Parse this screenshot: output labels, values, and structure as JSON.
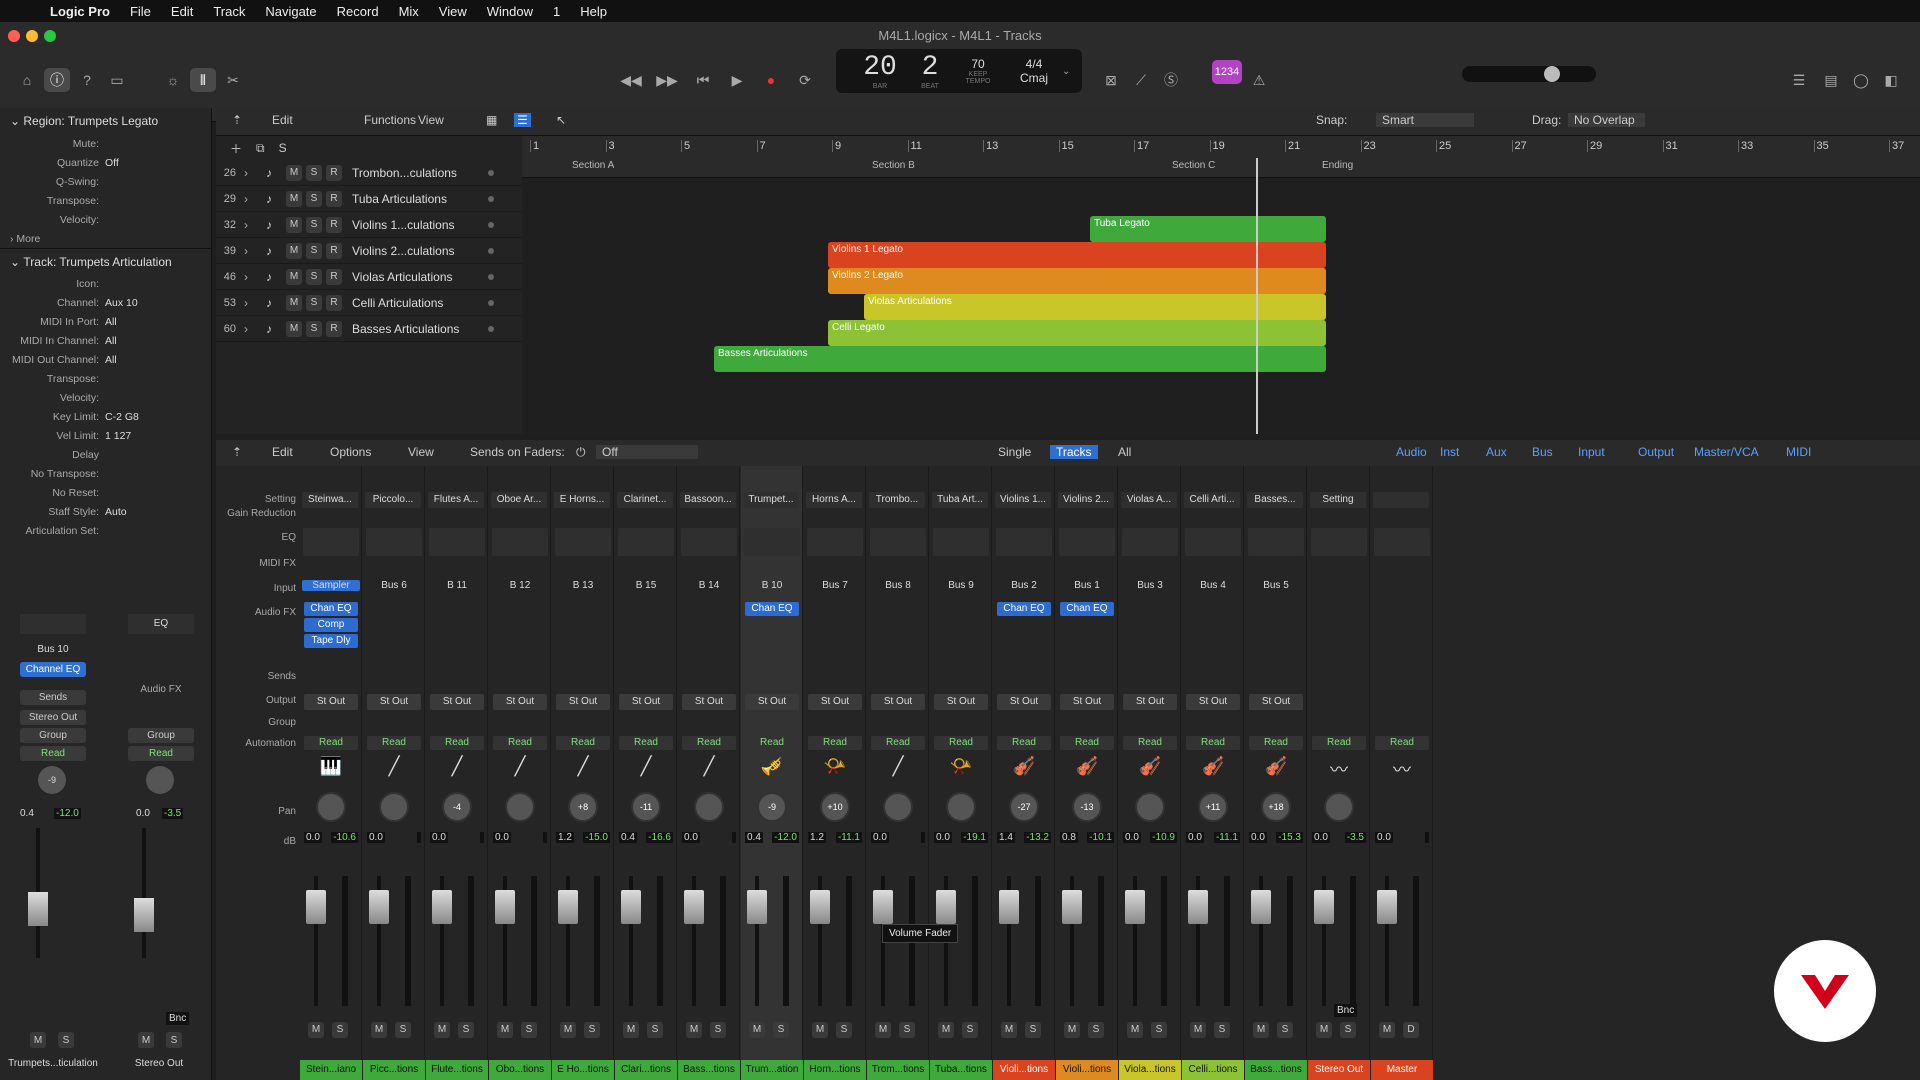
{
  "menubar": {
    "app": "Logic Pro",
    "items": [
      "File",
      "Edit",
      "Track",
      "Navigate",
      "Record",
      "Mix",
      "View",
      "Window",
      "1",
      "Help"
    ]
  },
  "window": {
    "title": "M4L1.logicx - M4L1 - Tracks"
  },
  "lcd": {
    "bar": "20",
    "beat": "2",
    "bar_label": "BAR",
    "beat_label": "BEAT",
    "tempo": "70",
    "keep": "KEEP",
    "tempo_label": "TEMPO",
    "sig": "4/4",
    "key": "Cmaj"
  },
  "cpu": {
    "label": "1234"
  },
  "inspector": {
    "region_header": "Region: Trumpets Legato",
    "region_rows": [
      {
        "k": "Mute:",
        "v": ""
      },
      {
        "k": "Quantize",
        "v": "Off"
      },
      {
        "k": "Q-Swing:",
        "v": ""
      },
      {
        "k": "Transpose:",
        "v": ""
      },
      {
        "k": "Velocity:",
        "v": ""
      }
    ],
    "more": "More",
    "track_header": "Track: Trumpets Articulation",
    "track_rows": [
      {
        "k": "Icon:",
        "v": ""
      },
      {
        "k": "Channel:",
        "v": "Aux 10"
      },
      {
        "k": "MIDI In Port:",
        "v": "All"
      },
      {
        "k": "MIDI In Channel:",
        "v": "All"
      },
      {
        "k": "MIDI Out Channel:",
        "v": "All"
      },
      {
        "k": "Transpose:",
        "v": ""
      },
      {
        "k": "Velocity:",
        "v": ""
      },
      {
        "k": "Key Limit:",
        "v": "C-2  G8"
      },
      {
        "k": "Vel Limit:",
        "v": "1  127"
      },
      {
        "k": "Delay",
        "v": ""
      },
      {
        "k": "No Transpose:",
        "v": ""
      },
      {
        "k": "No Reset:",
        "v": ""
      },
      {
        "k": "Staff Style:",
        "v": "Auto"
      },
      {
        "k": "Articulation Set:",
        "v": ""
      }
    ],
    "strip1": {
      "bus": "Bus 10",
      "fx": "Channel EQ",
      "sends": "Sends",
      "out": "Stereo Out",
      "group": "Group",
      "read": "Read",
      "pan": "-9",
      "vol": "0.4",
      "peak": "-12.0",
      "name": "Trumpets...ticulation"
    },
    "strip2": {
      "eq": "EQ",
      "fx": "Audio FX",
      "group": "Group",
      "read": "Read",
      "vol": "0.0",
      "peak": "-3.5",
      "bnc": "Bnc",
      "name": "Stereo Out"
    }
  },
  "tracks_toolbar": {
    "edit": "Edit",
    "functions": "Functions",
    "view": "View",
    "snap_label": "Snap:",
    "snap": "Smart",
    "drag_label": "Drag:",
    "drag": "No Overlap"
  },
  "tracks": [
    {
      "num": "26",
      "name": "Trombon...culations"
    },
    {
      "num": "29",
      "name": "Tuba Articulations"
    },
    {
      "num": "32",
      "name": "Violins 1...culations"
    },
    {
      "num": "39",
      "name": "Violins 2...culations"
    },
    {
      "num": "46",
      "name": "Violas Articulations"
    },
    {
      "num": "53",
      "name": "Celli Articulations"
    },
    {
      "num": "60",
      "name": "Basses Articulations"
    }
  ],
  "ruler": {
    "bars": [
      "1",
      "3",
      "5",
      "7",
      "9",
      "11",
      "13",
      "15",
      "17",
      "19",
      "21",
      "23",
      "25",
      "27",
      "29",
      "31",
      "33",
      "35",
      "37"
    ],
    "markers": [
      "Section A",
      "Section B",
      "Section C",
      "Ending"
    ]
  },
  "regions": [
    {
      "name": "Tuba Legato",
      "color": "#3fa93c"
    },
    {
      "name": "Violins 1 Legato",
      "color": "#d9431f"
    },
    {
      "name": "Violins 2 Legato",
      "color": "#df8a1f"
    },
    {
      "name": "Violas Articulations",
      "color": "#c9c62a"
    },
    {
      "name": "Celli Legato",
      "color": "#8cc233"
    },
    {
      "name": "Basses Articulations",
      "color": "#3fa93c"
    }
  ],
  "mixer_toolbar": {
    "edit": "Edit",
    "options": "Options",
    "view": "View",
    "sends_on_faders": "Sends on Faders:",
    "sends_value": "Off",
    "single": "Single",
    "tracks": "Tracks",
    "all": "All",
    "filters": [
      "Audio",
      "Inst",
      "Aux",
      "Bus",
      "Input",
      "Output",
      "Master/VCA",
      "MIDI"
    ]
  },
  "row_labels": {
    "setting": "Setting",
    "gain": "Gain Reduction",
    "eq": "EQ",
    "midifx": "MIDI FX",
    "input": "Input",
    "audiofx": "Audio FX",
    "sends": "Sends",
    "output": "Output",
    "group": "Group",
    "automation": "Automation",
    "pan": "Pan",
    "db": "dB"
  },
  "strips": [
    {
      "name": "Steinwa...",
      "input": "Sampler",
      "fx": [
        "Chan EQ",
        "Comp",
        "Tape Dly"
      ],
      "pan": "",
      "vol": "0.0",
      "peak": "-10.6",
      "label": "Stein...iano",
      "color": "#3fa93c",
      "icon": "🎹"
    },
    {
      "name": "Piccolo...",
      "input": "Bus 6",
      "fx": [],
      "pan": "",
      "vol": "0.0",
      "peak": "",
      "label": "Picc...tions",
      "color": "#3fa93c",
      "icon": "╱"
    },
    {
      "name": "Flutes A...",
      "input": "B 11",
      "fx": [],
      "pan": "-4",
      "vol": "0.0",
      "peak": "",
      "label": "Flute...tions",
      "color": "#3fa93c",
      "icon": "╱"
    },
    {
      "name": "Oboe Ar...",
      "input": "B 12",
      "fx": [],
      "pan": "",
      "vol": "0.0",
      "peak": "",
      "label": "Obo...tions",
      "color": "#3fa93c",
      "icon": "╱"
    },
    {
      "name": "E Horns...",
      "input": "B 13",
      "fx": [],
      "pan": "+8",
      "vol": "1.2",
      "peak": "-15.0",
      "label": "E Ho...tions",
      "color": "#3fa93c",
      "icon": "╱"
    },
    {
      "name": "Clarinet...",
      "input": "B 15",
      "fx": [],
      "pan": "-11",
      "vol": "0.4",
      "peak": "-16.6",
      "label": "Clari...tions",
      "color": "#3fa93c",
      "icon": "╱"
    },
    {
      "name": "Bassoon...",
      "input": "B 14",
      "fx": [],
      "pan": "",
      "vol": "0.0",
      "peak": "",
      "label": "Bass...tions",
      "color": "#3fa93c",
      "icon": "╱"
    },
    {
      "name": "Trumpet...",
      "input": "B 10",
      "fx": [
        "Chan EQ"
      ],
      "pan": "-9",
      "vol": "0.4",
      "peak": "-12.0",
      "label": "Trum...ation",
      "color": "#3fa93c",
      "icon": "🎺"
    },
    {
      "name": "Horns A...",
      "input": "Bus 7",
      "fx": [],
      "pan": "+10",
      "vol": "1.2",
      "peak": "-11.1",
      "label": "Horn...tions",
      "color": "#3fa93c",
      "icon": "📯"
    },
    {
      "name": "Trombo...",
      "input": "Bus 8",
      "fx": [],
      "pan": "",
      "vol": "0.0",
      "peak": "",
      "label": "Trom...tions",
      "color": "#3fa93c",
      "icon": "╱"
    },
    {
      "name": "Tuba Art...",
      "input": "Bus 9",
      "fx": [],
      "pan": "",
      "vol": "0.0",
      "peak": "-19.1",
      "label": "Tuba...tions",
      "color": "#3fa93c",
      "icon": "📯"
    },
    {
      "name": "Violins 1...",
      "input": "Bus 2",
      "fx": [
        "Chan EQ"
      ],
      "pan": "-27",
      "vol": "1.4",
      "peak": "-13.2",
      "label": "Violi...tions",
      "color": "#d9431f",
      "icon": "🎻"
    },
    {
      "name": "Violins 2...",
      "input": "Bus 1",
      "fx": [
        "Chan EQ"
      ],
      "pan": "-13",
      "vol": "0.8",
      "peak": "-10.1",
      "label": "Violi...tions",
      "color": "#df8a1f",
      "icon": "🎻"
    },
    {
      "name": "Violas A...",
      "input": "Bus 3",
      "fx": [],
      "pan": "",
      "vol": "0.0",
      "peak": "-10.9",
      "label": "Viola...tions",
      "color": "#c9c62a",
      "icon": "🎻"
    },
    {
      "name": "Celli Arti...",
      "input": "Bus 4",
      "fx": [],
      "pan": "+11",
      "vol": "0.0",
      "peak": "-11.1",
      "label": "Celli...tions",
      "color": "#8cc233",
      "icon": "🎻"
    },
    {
      "name": "Basses...",
      "input": "Bus 5",
      "fx": [],
      "pan": "+18",
      "vol": "0.0",
      "peak": "-15.3",
      "label": "Bass...tions",
      "color": "#3fa93c",
      "icon": "🎻"
    },
    {
      "name": "Setting",
      "input": "",
      "fx": [],
      "pan": "",
      "vol": "0.0",
      "peak": "-3.5",
      "label": "Stereo Out",
      "color": "#d9431f",
      "icon": "〰"
    },
    {
      "name": "",
      "input": "",
      "fx": [],
      "pan": "",
      "vol": "0.0",
      "peak": "",
      "label": "Master",
      "color": "#d9431f",
      "icon": "〰"
    }
  ],
  "output_label": "St Out",
  "read_label": "Read",
  "bnc": "Bnc",
  "tooltip": "Volume Fader",
  "colors": {
    "accent": "#2e6fd1",
    "read": "#7fe07a"
  }
}
